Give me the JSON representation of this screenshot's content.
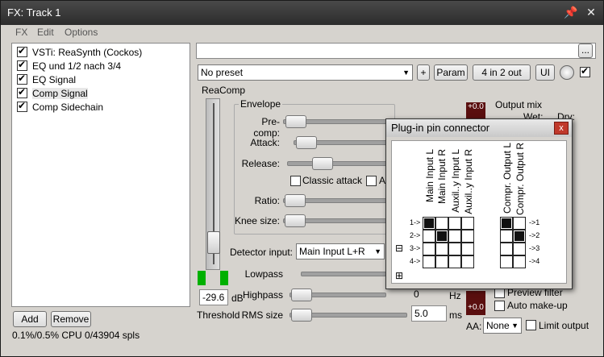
{
  "window": {
    "title": "FX: Track 1",
    "pin_glyph": "📌",
    "close_glyph": "✕"
  },
  "menu": [
    "FX",
    "Edit",
    "Options"
  ],
  "fx_list": [
    {
      "label": "VSTi: ReaSynth (Cockos)",
      "checked": true
    },
    {
      "label": "EQ und 1/2 nach 3/4",
      "checked": true
    },
    {
      "label": "EQ Signal",
      "checked": true
    },
    {
      "label": "Comp Signal",
      "checked": true,
      "selected": true
    },
    {
      "label": "Comp Sidechain",
      "checked": true
    }
  ],
  "buttons": {
    "add": "Add",
    "remove": "Remove",
    "browse": "...",
    "plus": "+",
    "param": "Param",
    "routing": "4 in 2 out",
    "ui": "UI"
  },
  "cpu_status": "0.1%/0.5% CPU 0/43904 spls",
  "preset": {
    "value": "No preset"
  },
  "plugin": {
    "name": "ReaComp",
    "envelope_label": "Envelope",
    "rows": {
      "precomp": "Pre-comp:",
      "attack": "Attack:",
      "release": "Release:",
      "classic_attack": "Classic attack",
      "auto_partial": "A",
      "ratio": "Ratio:",
      "knee": "Knee size:",
      "detector": "Detector input:",
      "detector_value": "Main Input L+R",
      "lowpass": "Lowpass",
      "highpass": "Highpass",
      "highpass_value": "0",
      "highpass_unit": "Hz",
      "rms": "RMS size",
      "rms_value": "5.0",
      "rms_unit": "ms"
    },
    "threshold": {
      "value": "-29.6",
      "unit": "dB",
      "label": "Threshold"
    },
    "output_mix": {
      "label": "Output mix",
      "wet": "Wet:",
      "dry": "Dry:"
    },
    "meter_top": "+0.0",
    "meter_bottom": "+0.0",
    "preview_filter": "Preview filter",
    "auto_makeup": "Auto make-up",
    "aa_label": "AA:",
    "aa_value": "None",
    "limit_output": "Limit output"
  },
  "pin_connector": {
    "title": "Plug-in pin connector",
    "close": "x",
    "inputs": [
      "Main Input L",
      "Main Input R",
      "Auxil..y Input L",
      "Auxil..y Input R"
    ],
    "outputs": [
      "Compr. Output L",
      "Compr. Output R"
    ],
    "rows_in": [
      "1->",
      "2->",
      "3->",
      "4->"
    ],
    "rows_out": [
      "->1",
      "->2",
      "->3",
      "->4"
    ],
    "in_matrix": [
      [
        1,
        0,
        0,
        0
      ],
      [
        0,
        1,
        0,
        0
      ],
      [
        0,
        0,
        0,
        0
      ],
      [
        0,
        0,
        0,
        0
      ]
    ],
    "out_matrix": [
      [
        1,
        0
      ],
      [
        0,
        1
      ],
      [
        0,
        0
      ],
      [
        0,
        0
      ]
    ],
    "minus": "⊟",
    "plus": "⊞"
  }
}
